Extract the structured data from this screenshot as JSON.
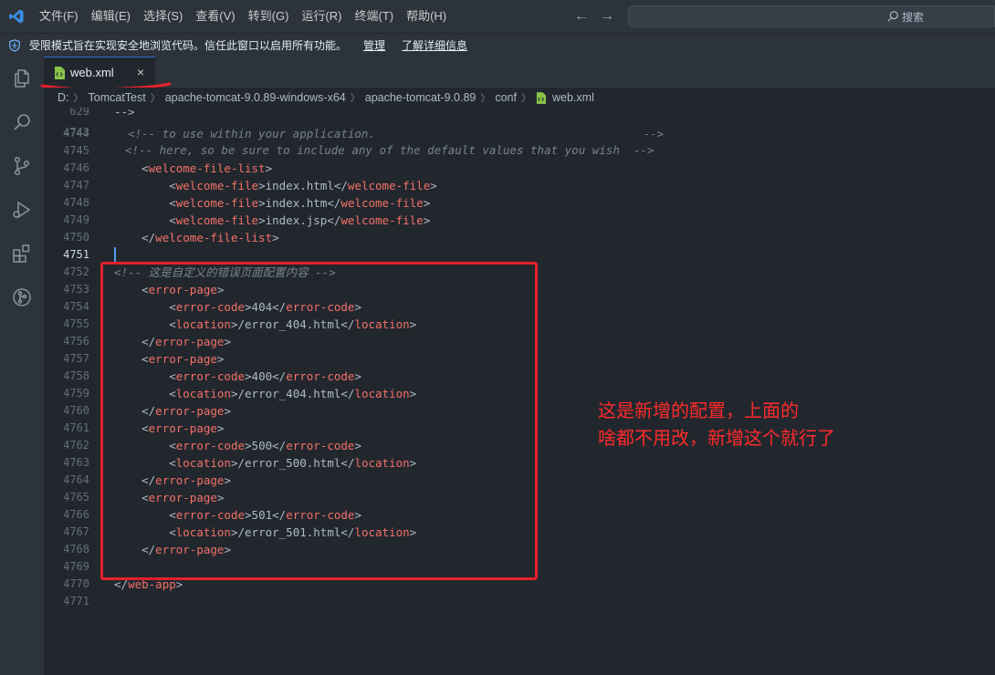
{
  "menu": [
    "文件(F)",
    "编辑(E)",
    "选择(S)",
    "查看(V)",
    "转到(G)",
    "运行(R)",
    "终端(T)",
    "帮助(H)"
  ],
  "search": {
    "label": "搜索"
  },
  "banner": {
    "text": "受限模式旨在实现安全地浏览代码。信任此窗口以启用所有功能。",
    "manage": "管理",
    "learn_more": "了解详细信息"
  },
  "tab": {
    "label": "web.xml",
    "close": "×"
  },
  "breadcrumb": [
    "D:",
    "TomcatTest",
    "apache-tomcat-9.0.89-windows-x64",
    "apache-tomcat-9.0.89",
    "conf",
    "web.xml"
  ],
  "editor": {
    "sticky_line": {
      "num": "629",
      "text": "-->"
    },
    "partial_line": {
      "num": "4743",
      "text": "<!-- here, so be sure to include any of the default values that you wish  -->"
    },
    "lines": [
      {
        "num": "4744",
        "indent": "  ",
        "parts": [
          [
            "c",
            "<!-- to use within your application.                                       -->"
          ]
        ]
      },
      {
        "num": "4745",
        "indent": "",
        "parts": []
      },
      {
        "num": "4746",
        "indent": "    ",
        "parts": [
          [
            "p",
            "<"
          ],
          [
            "t",
            "welcome-file-list"
          ],
          [
            "p",
            ">"
          ]
        ]
      },
      {
        "num": "4747",
        "indent": "        ",
        "parts": [
          [
            "p",
            "<"
          ],
          [
            "t",
            "welcome-file"
          ],
          [
            "p",
            ">"
          ],
          [
            "x",
            "index.html"
          ],
          [
            "p",
            "</"
          ],
          [
            "t",
            "welcome-file"
          ],
          [
            "p",
            ">"
          ]
        ]
      },
      {
        "num": "4748",
        "indent": "        ",
        "parts": [
          [
            "p",
            "<"
          ],
          [
            "t",
            "welcome-file"
          ],
          [
            "p",
            ">"
          ],
          [
            "x",
            "index.htm"
          ],
          [
            "p",
            "</"
          ],
          [
            "t",
            "welcome-file"
          ],
          [
            "p",
            ">"
          ]
        ]
      },
      {
        "num": "4749",
        "indent": "        ",
        "parts": [
          [
            "p",
            "<"
          ],
          [
            "t",
            "welcome-file"
          ],
          [
            "p",
            ">"
          ],
          [
            "x",
            "index.jsp"
          ],
          [
            "p",
            "</"
          ],
          [
            "t",
            "welcome-file"
          ],
          [
            "p",
            ">"
          ]
        ]
      },
      {
        "num": "4750",
        "indent": "    ",
        "parts": [
          [
            "p",
            "</"
          ],
          [
            "t",
            "welcome-file-list"
          ],
          [
            "p",
            ">"
          ]
        ]
      },
      {
        "num": "4751",
        "indent": "",
        "parts": [],
        "active": true
      },
      {
        "num": "4752",
        "indent": "",
        "parts": [
          [
            "c",
            "<!-- 这是自定义的错误页面配置内容 -->"
          ]
        ]
      },
      {
        "num": "4753",
        "indent": "    ",
        "parts": [
          [
            "p",
            "<"
          ],
          [
            "t",
            "error-page"
          ],
          [
            "p",
            ">"
          ]
        ]
      },
      {
        "num": "4754",
        "indent": "        ",
        "parts": [
          [
            "p",
            "<"
          ],
          [
            "t",
            "error-code"
          ],
          [
            "p",
            ">"
          ],
          [
            "x",
            "404"
          ],
          [
            "p",
            "</"
          ],
          [
            "t",
            "error-code"
          ],
          [
            "p",
            ">"
          ]
        ]
      },
      {
        "num": "4755",
        "indent": "        ",
        "parts": [
          [
            "p",
            "<"
          ],
          [
            "t",
            "location"
          ],
          [
            "p",
            ">"
          ],
          [
            "x",
            "/error_404.html"
          ],
          [
            "p",
            "</"
          ],
          [
            "t",
            "location"
          ],
          [
            "p",
            ">"
          ]
        ]
      },
      {
        "num": "4756",
        "indent": "    ",
        "parts": [
          [
            "p",
            "</"
          ],
          [
            "t",
            "error-page"
          ],
          [
            "p",
            ">"
          ]
        ]
      },
      {
        "num": "4757",
        "indent": "    ",
        "parts": [
          [
            "p",
            "<"
          ],
          [
            "t",
            "error-page"
          ],
          [
            "p",
            ">"
          ]
        ]
      },
      {
        "num": "4758",
        "indent": "        ",
        "parts": [
          [
            "p",
            "<"
          ],
          [
            "t",
            "error-code"
          ],
          [
            "p",
            ">"
          ],
          [
            "x",
            "400"
          ],
          [
            "p",
            "</"
          ],
          [
            "t",
            "error-code"
          ],
          [
            "p",
            ">"
          ]
        ]
      },
      {
        "num": "4759",
        "indent": "        ",
        "parts": [
          [
            "p",
            "<"
          ],
          [
            "t",
            "location"
          ],
          [
            "p",
            ">"
          ],
          [
            "x",
            "/error_404.html"
          ],
          [
            "p",
            "</"
          ],
          [
            "t",
            "location"
          ],
          [
            "p",
            ">"
          ]
        ]
      },
      {
        "num": "4760",
        "indent": "    ",
        "parts": [
          [
            "p",
            "</"
          ],
          [
            "t",
            "error-page"
          ],
          [
            "p",
            ">"
          ]
        ]
      },
      {
        "num": "4761",
        "indent": "    ",
        "parts": [
          [
            "p",
            "<"
          ],
          [
            "t",
            "error-page"
          ],
          [
            "p",
            ">"
          ]
        ]
      },
      {
        "num": "4762",
        "indent": "        ",
        "parts": [
          [
            "p",
            "<"
          ],
          [
            "t",
            "error-code"
          ],
          [
            "p",
            ">"
          ],
          [
            "x",
            "500"
          ],
          [
            "p",
            "</"
          ],
          [
            "t",
            "error-code"
          ],
          [
            "p",
            ">"
          ]
        ]
      },
      {
        "num": "4763",
        "indent": "        ",
        "parts": [
          [
            "p",
            "<"
          ],
          [
            "t",
            "location"
          ],
          [
            "p",
            ">"
          ],
          [
            "x",
            "/error_500.html"
          ],
          [
            "p",
            "</"
          ],
          [
            "t",
            "location"
          ],
          [
            "p",
            ">"
          ]
        ]
      },
      {
        "num": "4764",
        "indent": "    ",
        "parts": [
          [
            "p",
            "</"
          ],
          [
            "t",
            "error-page"
          ],
          [
            "p",
            ">"
          ]
        ]
      },
      {
        "num": "4765",
        "indent": "    ",
        "parts": [
          [
            "p",
            "<"
          ],
          [
            "t",
            "error-page"
          ],
          [
            "p",
            ">"
          ]
        ]
      },
      {
        "num": "4766",
        "indent": "        ",
        "parts": [
          [
            "p",
            "<"
          ],
          [
            "t",
            "error-code"
          ],
          [
            "p",
            ">"
          ],
          [
            "x",
            "501"
          ],
          [
            "p",
            "</"
          ],
          [
            "t",
            "error-code"
          ],
          [
            "p",
            ">"
          ]
        ]
      },
      {
        "num": "4767",
        "indent": "        ",
        "parts": [
          [
            "p",
            "<"
          ],
          [
            "t",
            "location"
          ],
          [
            "p",
            ">"
          ],
          [
            "x",
            "/error_501.html"
          ],
          [
            "p",
            "</"
          ],
          [
            "t",
            "location"
          ],
          [
            "p",
            ">"
          ]
        ]
      },
      {
        "num": "4768",
        "indent": "    ",
        "parts": [
          [
            "p",
            "</"
          ],
          [
            "t",
            "error-page"
          ],
          [
            "p",
            ">"
          ]
        ]
      },
      {
        "num": "4769",
        "indent": "",
        "parts": []
      },
      {
        "num": "4770",
        "indent": "",
        "parts": [
          [
            "p",
            "</"
          ],
          [
            "t",
            "web-app"
          ],
          [
            "p",
            ">"
          ]
        ]
      },
      {
        "num": "4771",
        "indent": "",
        "parts": []
      }
    ]
  },
  "annotation": {
    "text": "这是新增的配置，上面的\n啥都不用改，新增这个就行了"
  },
  "icons": [
    "vscode-logo-icon",
    "explorer-icon",
    "search-icon",
    "source-control-icon",
    "run-debug-icon",
    "extensions-icon",
    "git-graph-icon",
    "shield-icon",
    "xml-file-icon",
    "arrow-left-icon",
    "arrow-right-icon"
  ],
  "colors": {
    "background": "#22272e",
    "chrome": "#2d333b",
    "tag": "#f47067",
    "comment": "#768390",
    "annotation": "#e8202a",
    "file_icon": "#8bc34a"
  }
}
